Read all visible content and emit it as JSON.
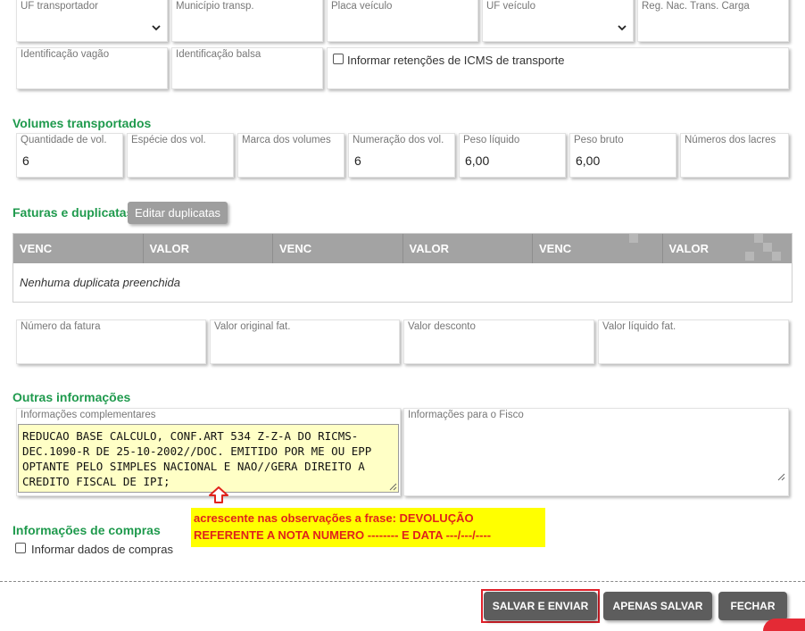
{
  "transport": {
    "uf_transportador_label": "UF transportador",
    "municipio_label": "Município transp.",
    "placa_label": "Placa veículo",
    "uf_veiculo_label": "UF veículo",
    "reg_nac_label": "Reg. Nac. Trans. Carga",
    "vagao_label": "Identificação vagão",
    "balsa_label": "Identificação balsa",
    "icms_checkbox_label": "Informar retenções de ICMS de transporte"
  },
  "volumes": {
    "title": "Volumes transportados",
    "fields": [
      {
        "label": "Quantidade de vol.",
        "value": "6"
      },
      {
        "label": "Espécie dos vol.",
        "value": ""
      },
      {
        "label": "Marca dos volumes",
        "value": ""
      },
      {
        "label": "Numeração dos vol.",
        "value": "6"
      },
      {
        "label": "Peso líquido",
        "value": "6,00"
      },
      {
        "label": "Peso bruto",
        "value": "6,00"
      },
      {
        "label": "Números dos lacres",
        "value": ""
      }
    ]
  },
  "faturas": {
    "title": "Faturas e duplicatas",
    "edit_button": "Editar duplicatas",
    "columns": [
      "VENC",
      "VALOR",
      "VENC",
      "VALOR",
      "VENC",
      "VALOR"
    ],
    "empty_text": "Nenhuma duplicata preenchida",
    "fields": [
      {
        "label": "Número da fatura",
        "value": ""
      },
      {
        "label": "Valor original fat.",
        "value": ""
      },
      {
        "label": "Valor desconto",
        "value": ""
      },
      {
        "label": "Valor líquido fat.",
        "value": ""
      }
    ]
  },
  "outras": {
    "title": "Outras informações",
    "complementares_label": "Informações complementares",
    "complementares_value": "REDUCAO BASE CALCULO, CONF.ART 534 Z-Z-A DO RICMS-\nDEC.1090-R DE 25-10-2002//DOC. EMITIDO POR ME OU EPP\nOPTANTE PELO SIMPLES NACIONAL E NAO//GERA DIREITO A\nCREDITO FISCAL DE IPI;",
    "fisco_label": "Informações para o Fisco",
    "fisco_value": ""
  },
  "annotation": {
    "note": "acrescente nas observações a frase: DEVOLUÇÃO REFERENTE A NOTA NUMERO -------- E DATA ---/---/----",
    "arrow_color": "#e0231b"
  },
  "compras": {
    "title": "Informações de compras",
    "checkbox_label": "Informar dados de compras"
  },
  "footer": {
    "save_send": "SALVAR E ENVIAR",
    "save_only": "APENAS SALVAR",
    "close": "FECHAR"
  },
  "colors": {
    "section_title": "#1f9a4d",
    "table_header": "#a3a3a3",
    "button_dark": "#5d5d5d",
    "highlight_red": "#e0202a",
    "note_bg": "#ffff00"
  }
}
